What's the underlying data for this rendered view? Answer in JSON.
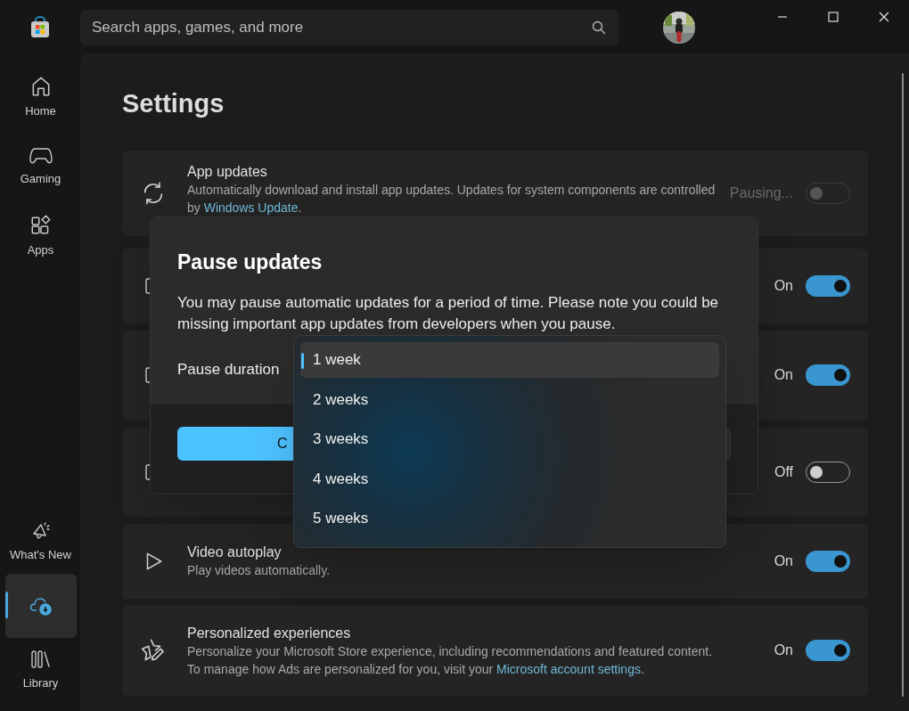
{
  "search": {
    "placeholder": "Search apps, games, and more"
  },
  "nav": [
    {
      "label": "Home",
      "selected": false
    },
    {
      "label": "Gaming",
      "selected": false
    },
    {
      "label": "Apps",
      "selected": false
    },
    {
      "label": "What's New",
      "selected": false
    },
    {
      "selected": true
    },
    {
      "label": "Library",
      "selected": false
    }
  ],
  "page_title": "Settings",
  "settings": [
    {
      "title": "App updates",
      "description": "Automatically download and install app updates. Updates for system components are controlled by ",
      "link": "Windows Update",
      "description_end": ".",
      "status": "Pausing...",
      "on": false,
      "disabled": true
    },
    {
      "status": "On",
      "on": true
    },
    {
      "status": "On",
      "on": true
    },
    {
      "status": "Off",
      "on": false
    },
    {
      "title": "Video autoplay",
      "description": "Play videos automatically.",
      "status": "On",
      "on": true
    },
    {
      "title": "Personalized experiences",
      "description": "Personalize your Microsoft Store experience, including recommendations and featured content. To manage how Ads are personalized for you, visit your ",
      "link": "Microsoft account settings",
      "description_end": ".",
      "status": "On",
      "on": true
    }
  ],
  "dialog": {
    "title": "Pause updates",
    "text": "You may pause automatic updates for a period of time. Please note you could be missing important app updates from developers when you pause.",
    "field_label": "Pause duration",
    "primary_button": "C",
    "options": [
      {
        "label": "1 week",
        "selected": true
      },
      {
        "label": "2 weeks",
        "selected": false
      },
      {
        "label": "3 weeks",
        "selected": false
      },
      {
        "label": "4 weeks",
        "selected": false
      },
      {
        "label": "5 weeks",
        "selected": false
      }
    ]
  }
}
